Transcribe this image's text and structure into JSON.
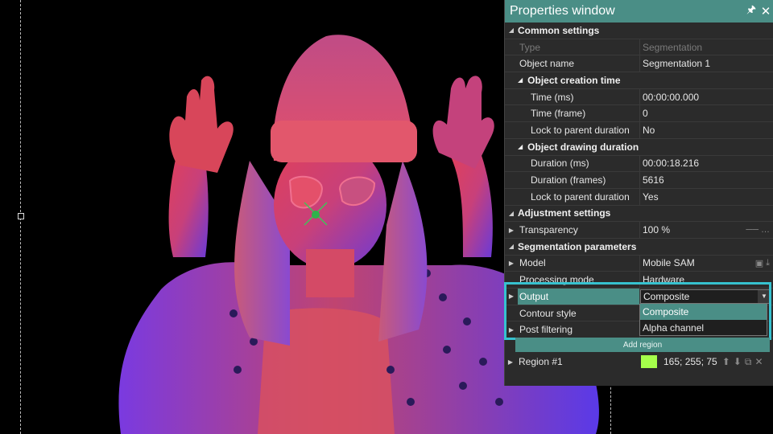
{
  "panel": {
    "title": "Properties window",
    "pin_icon": "pin-icon",
    "close_icon": "close-icon"
  },
  "sections": {
    "common": "Common settings",
    "creation": "Object creation time",
    "drawing": "Object drawing duration",
    "adjust": "Adjustment settings",
    "seg": "Segmentation parameters"
  },
  "props": {
    "type": {
      "name": "Type",
      "value": "Segmentation"
    },
    "object_name": {
      "name": "Object name",
      "value": "Segmentation 1"
    },
    "time_ms": {
      "name": "Time (ms)",
      "value": "00:00:00.000"
    },
    "time_frame": {
      "name": "Time (frame)",
      "value": "0"
    },
    "lock_parent_1": {
      "name": "Lock to parent duration",
      "value": "No"
    },
    "duration_ms": {
      "name": "Duration (ms)",
      "value": "00:00:18.216"
    },
    "duration_frames": {
      "name": "Duration (frames)",
      "value": "5616"
    },
    "lock_parent_2": {
      "name": "Lock to parent duration",
      "value": "Yes"
    },
    "transparency": {
      "name": "Transparency",
      "value": "100 %"
    },
    "model": {
      "name": "Model",
      "value": "Mobile SAM"
    },
    "processing_mode": {
      "name": "Processing mode",
      "value": "Hardware"
    },
    "output": {
      "name": "Output",
      "value": "Composite"
    },
    "contour_style": {
      "name": "Contour style",
      "value": ""
    },
    "post_filtering": {
      "name": "Post filtering",
      "value": ""
    }
  },
  "output_options": [
    "Composite",
    "Alpha channel"
  ],
  "add_region_label": "Add region",
  "region": {
    "name": "Region #1",
    "color": "#a5ff4b",
    "value": "165; 255; 75"
  },
  "colors": {
    "accent": "#4a8e86",
    "highlight": "#36c1cf",
    "marker": "#2fb34a"
  }
}
